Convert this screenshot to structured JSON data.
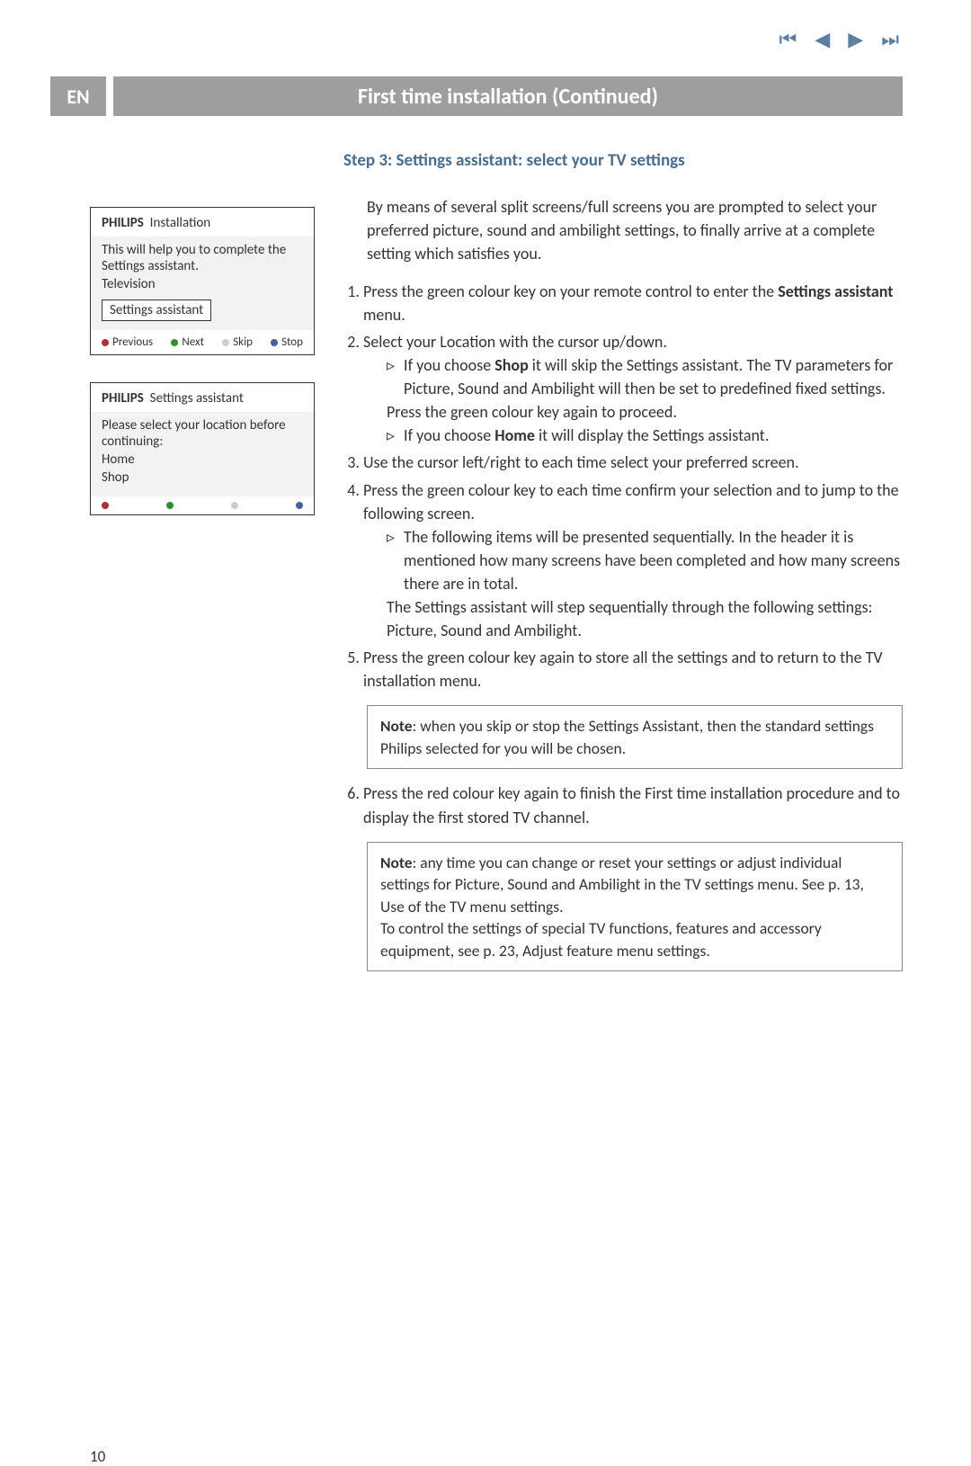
{
  "lang_badge": "EN",
  "page_title": "First time installation  (Continued)",
  "step_heading": "Step 3: Settings assistant: select your TV settings",
  "intro": "By means of several split screens/full screens you are prompted to select your preferred picture, sound and ambilight settings, to finally arrive at a complete setting which satisfies you.",
  "panel1": {
    "brand": "PHILIPS",
    "title": "Installation",
    "body_lines": [
      "This will help you to complete the Settings assistant.",
      "Television"
    ],
    "selected": "Settings assistant",
    "footer": [
      {
        "color": "red",
        "label": "Previous",
        "on": true
      },
      {
        "color": "green",
        "label": "Next",
        "on": true
      },
      {
        "color": "yellow",
        "label": "Skip",
        "on": false
      },
      {
        "color": "blue",
        "label": "Stop",
        "on": true
      }
    ]
  },
  "panel2": {
    "brand": "PHILIPS",
    "title": "Settings assistant",
    "body_lines": [
      "Please select your location before continuing:",
      "Home",
      "Shop"
    ],
    "footer": [
      {
        "color": "red",
        "label": "",
        "on": true
      },
      {
        "color": "green",
        "label": "",
        "on": true
      },
      {
        "color": "yellow",
        "label": "",
        "on": false
      },
      {
        "color": "blue",
        "label": "",
        "on": true
      }
    ]
  },
  "steps": {
    "s1_a": "Press the green colour key on your remote control to enter the ",
    "s1_b_bold": "Settings assistant",
    "s1_c": " menu.",
    "s2": "Select your Location with the cursor up/down.",
    "s2_shop_a": "If you choose ",
    "s2_shop_bold": "Shop",
    "s2_shop_b": " it will skip the Settings assistant. The TV parameters for Picture, Sound and Ambilight will then be set to predefined fixed settings.",
    "s2_press": "Press the green colour key again to proceed.",
    "s2_home_a": "If you choose ",
    "s2_home_bold": "Home",
    "s2_home_b": " it will display the Settings assistant.",
    "s3": "Use the cursor left/right to each time select your preferred screen.",
    "s4": "Press the green colour key to each time confirm your selection and to jump to the following screen.",
    "s4_sub": "The following items will be presented sequentially. In the header it is mentioned how many screens have been completed and how many screens there are in total.",
    "s4_tail": "The Settings assistant will step sequentially through the following settings: Picture, Sound and Ambilight.",
    "s5": "Press the green colour key again to store all the settings and to return to the TV installation menu.",
    "note1_bold": "Note",
    "note1": ": when you skip or stop the Settings Assistant, then the standard settings Philips selected for you will be chosen.",
    "s6": "Press the red colour key again to finish the First time installation procedure and to display the first stored TV channel.",
    "note2_bold": "Note",
    "note2_a": ": any time you can change or reset your settings or adjust individual settings for Picture, Sound and Ambilight in the TV settings menu. See p. 13, Use of the TV menu settings.",
    "note2_b": "To control the settings of special TV functions, features and accessory equipment, see p. 23,  Adjust feature menu settings."
  },
  "page_number": "10"
}
